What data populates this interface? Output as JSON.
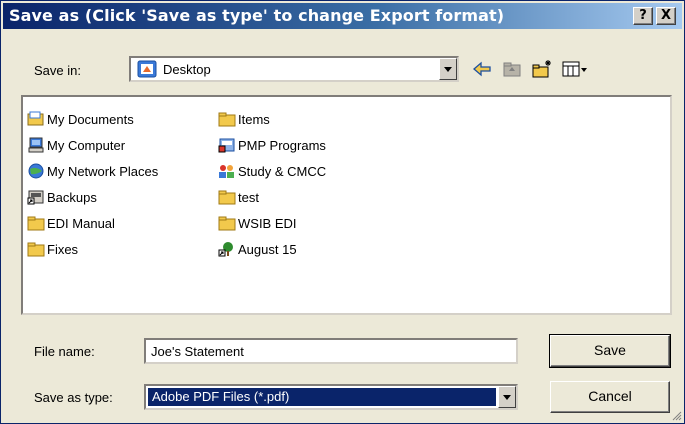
{
  "window": {
    "title": "Save as (Click 'Save as type' to change Export format)",
    "help_label": "?",
    "close_label": "X"
  },
  "save_in": {
    "label": "Save in:",
    "value": "Desktop",
    "icon": "desktop-icon"
  },
  "toolbar": {
    "icons": [
      "back-arrow-icon",
      "up-folder-icon",
      "new-folder-icon",
      "view-menu-icon"
    ]
  },
  "files": {
    "column1": [
      {
        "name": "My Documents",
        "icon": "my-documents-icon"
      },
      {
        "name": "My Computer",
        "icon": "my-computer-icon"
      },
      {
        "name": "My Network Places",
        "icon": "network-places-icon"
      },
      {
        "name": "Backups",
        "icon": "shortcut-icon"
      },
      {
        "name": "EDI Manual",
        "icon": "folder-icon"
      },
      {
        "name": "Fixes",
        "icon": "folder-icon"
      }
    ],
    "column2": [
      {
        "name": "Items",
        "icon": "folder-icon"
      },
      {
        "name": "PMP Programs",
        "icon": "program-shortcut-icon"
      },
      {
        "name": "Study & CMCC",
        "icon": "shared-users-icon"
      },
      {
        "name": "test",
        "icon": "folder-icon"
      },
      {
        "name": "WSIB EDI",
        "icon": "folder-icon"
      },
      {
        "name": "August 15",
        "icon": "tree-shortcut-icon"
      }
    ]
  },
  "file_name": {
    "label": "File name:",
    "value": "Joe's Statement"
  },
  "save_as_type": {
    "label": "Save as type:",
    "value": "Adobe PDF Files (*.pdf)"
  },
  "buttons": {
    "save": "Save",
    "cancel": "Cancel"
  },
  "colors": {
    "title_bar": "#0a246a",
    "selection": "#0a246a",
    "dialog_bg": "#ece9d8",
    "folder": "#f2c94c"
  }
}
